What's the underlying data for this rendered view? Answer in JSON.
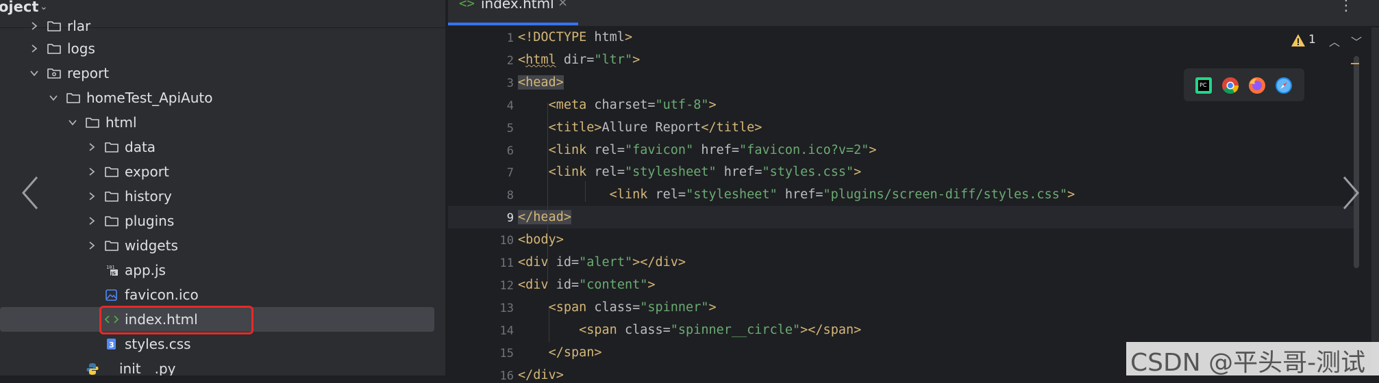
{
  "project": {
    "title": "oject",
    "rows": [
      {
        "label": "rlar",
        "type": "folder",
        "indent": 1,
        "expanded": false
      },
      {
        "label": "logs",
        "type": "folder",
        "indent": 1,
        "expanded": false
      },
      {
        "label": "report",
        "type": "folder-special",
        "indent": 1,
        "expanded": true
      },
      {
        "label": "homeTest_ApiAuto",
        "type": "folder",
        "indent": 2,
        "expanded": true
      },
      {
        "label": "html",
        "type": "folder",
        "indent": 3,
        "expanded": true
      },
      {
        "label": "data",
        "type": "folder",
        "indent": 4,
        "expanded": false
      },
      {
        "label": "export",
        "type": "folder",
        "indent": 4,
        "expanded": false
      },
      {
        "label": "history",
        "type": "folder",
        "indent": 4,
        "expanded": false
      },
      {
        "label": "plugins",
        "type": "folder",
        "indent": 4,
        "expanded": false
      },
      {
        "label": "widgets",
        "type": "folder",
        "indent": 4,
        "expanded": false
      },
      {
        "label": "app.js",
        "type": "js-file",
        "indent": 4
      },
      {
        "label": "favicon.ico",
        "type": "image-file",
        "indent": 4
      },
      {
        "label": "index.html",
        "type": "html-file",
        "indent": 4,
        "selected": true
      },
      {
        "label": "styles.css",
        "type": "css-file",
        "indent": 4
      },
      {
        "label": "__init__.py",
        "type": "python-file",
        "indent": 3
      }
    ]
  },
  "editor": {
    "tab": {
      "icon": "<>",
      "label": "index.html",
      "close": "×"
    },
    "more": "⋮",
    "inspection": {
      "warning_count": "1"
    },
    "browsers": [
      "pycharm-icon",
      "chrome-icon",
      "firefox-icon",
      "safari-icon"
    ],
    "current_line": 9,
    "lines": [
      {
        "n": "1",
        "segs": [
          [
            "tag",
            "<!DOCTYPE "
          ],
          [
            "attr",
            "html"
          ],
          [
            "tag",
            ">"
          ]
        ]
      },
      {
        "n": "2",
        "segs": [
          [
            "tag",
            "<"
          ],
          [
            "tagsq",
            "html"
          ],
          [
            "attr",
            " dir="
          ],
          [
            "str",
            "\"ltr\""
          ],
          [
            "tag",
            ">"
          ]
        ]
      },
      {
        "n": "3",
        "segs": [
          [
            "taghl",
            "<head>"
          ]
        ]
      },
      {
        "n": "4",
        "segs": [
          [
            "plain",
            "    "
          ],
          [
            "tag",
            "<meta"
          ],
          [
            "attr",
            " charset="
          ],
          [
            "str",
            "\"utf-8\""
          ],
          [
            "tag",
            ">"
          ]
        ]
      },
      {
        "n": "5",
        "segs": [
          [
            "plain",
            "    "
          ],
          [
            "tag",
            "<title>"
          ],
          [
            "plain",
            "Allure Report"
          ],
          [
            "tag",
            "</title>"
          ]
        ]
      },
      {
        "n": "6",
        "segs": [
          [
            "plain",
            "    "
          ],
          [
            "tag",
            "<link"
          ],
          [
            "attr",
            " rel="
          ],
          [
            "str",
            "\"favicon\""
          ],
          [
            "attr",
            " href="
          ],
          [
            "str",
            "\"favicon.ico?v=2\""
          ],
          [
            "tag",
            ">"
          ]
        ]
      },
      {
        "n": "7",
        "segs": [
          [
            "plain",
            "    "
          ],
          [
            "tag",
            "<link"
          ],
          [
            "attr",
            " rel="
          ],
          [
            "str",
            "\"stylesheet\""
          ],
          [
            "attr",
            " href="
          ],
          [
            "str",
            "\"styles.css\""
          ],
          [
            "tag",
            ">"
          ]
        ]
      },
      {
        "n": "8",
        "segs": [
          [
            "plain",
            "            "
          ],
          [
            "tag",
            "<link"
          ],
          [
            "attr",
            " rel="
          ],
          [
            "str",
            "\"stylesheet\""
          ],
          [
            "attr",
            " href="
          ],
          [
            "str",
            "\"plugins/screen-diff/styles.css\""
          ],
          [
            "tag",
            ">"
          ]
        ]
      },
      {
        "n": "9",
        "segs": [
          [
            "taghl",
            "</head>"
          ]
        ]
      },
      {
        "n": "10",
        "segs": [
          [
            "tag",
            "<body>"
          ]
        ]
      },
      {
        "n": "11",
        "segs": [
          [
            "tag",
            "<div"
          ],
          [
            "attr",
            " id="
          ],
          [
            "str",
            "\"alert\""
          ],
          [
            "tag",
            "></div>"
          ]
        ]
      },
      {
        "n": "12",
        "segs": [
          [
            "tag",
            "<div"
          ],
          [
            "attr",
            " id="
          ],
          [
            "str",
            "\"content\""
          ],
          [
            "tag",
            ">"
          ]
        ]
      },
      {
        "n": "13",
        "segs": [
          [
            "plain",
            "    "
          ],
          [
            "tag",
            "<span"
          ],
          [
            "attr",
            " class="
          ],
          [
            "str",
            "\"spinner\""
          ],
          [
            "tag",
            ">"
          ]
        ]
      },
      {
        "n": "14",
        "segs": [
          [
            "plain",
            "        "
          ],
          [
            "tag",
            "<span"
          ],
          [
            "attr",
            " class="
          ],
          [
            "str",
            "\"spinner__circle\""
          ],
          [
            "tag",
            "></span>"
          ]
        ]
      },
      {
        "n": "15",
        "segs": [
          [
            "plain",
            "    "
          ],
          [
            "tag",
            "</span>"
          ]
        ]
      },
      {
        "n": "16",
        "segs": [
          [
            "tag",
            "</div>"
          ]
        ]
      }
    ]
  },
  "watermark": "CSDN @平头哥-测试"
}
